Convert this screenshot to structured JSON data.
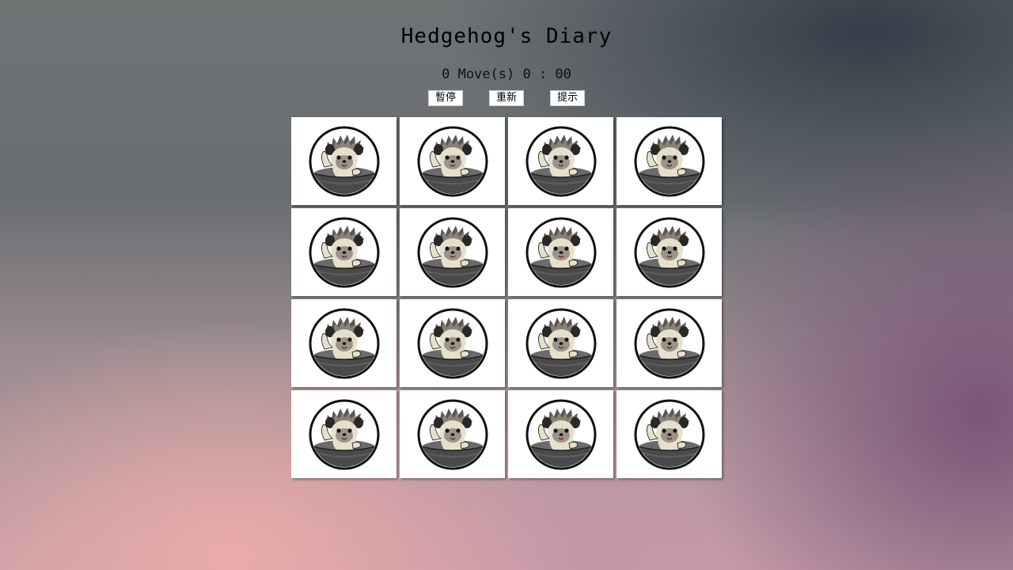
{
  "header": {
    "title": "Hedgehog's Diary"
  },
  "stats": {
    "moves": "0",
    "moves_label": "Move(s)",
    "timer": "0 : 00"
  },
  "controls": {
    "pause_label": "暫停",
    "restart_label": "重新",
    "hint_label": "提示"
  },
  "board": {
    "rows": 4,
    "columns": 4,
    "cards": [
      {
        "icon": "hedgehog-in-bowl-icon",
        "state": "face-up"
      },
      {
        "icon": "hedgehog-in-bowl-icon",
        "state": "face-up"
      },
      {
        "icon": "hedgehog-in-bowl-icon",
        "state": "face-up"
      },
      {
        "icon": "hedgehog-in-bowl-icon",
        "state": "face-up"
      },
      {
        "icon": "hedgehog-in-bowl-icon",
        "state": "face-up"
      },
      {
        "icon": "hedgehog-in-bowl-icon",
        "state": "face-up"
      },
      {
        "icon": "hedgehog-in-bowl-icon",
        "state": "face-up"
      },
      {
        "icon": "hedgehog-in-bowl-icon",
        "state": "face-up"
      },
      {
        "icon": "hedgehog-in-bowl-icon",
        "state": "face-up"
      },
      {
        "icon": "hedgehog-in-bowl-icon",
        "state": "face-up"
      },
      {
        "icon": "hedgehog-in-bowl-icon",
        "state": "face-up"
      },
      {
        "icon": "hedgehog-in-bowl-icon",
        "state": "face-up"
      },
      {
        "icon": "hedgehog-in-bowl-icon",
        "state": "face-up"
      },
      {
        "icon": "hedgehog-in-bowl-icon",
        "state": "face-up"
      },
      {
        "icon": "hedgehog-in-bowl-icon",
        "state": "face-up"
      },
      {
        "icon": "hedgehog-in-bowl-icon",
        "state": "face-up"
      }
    ]
  },
  "colors": {
    "card_background": "#ffffff",
    "button_background": "#ffffff",
    "text": "#000000"
  }
}
